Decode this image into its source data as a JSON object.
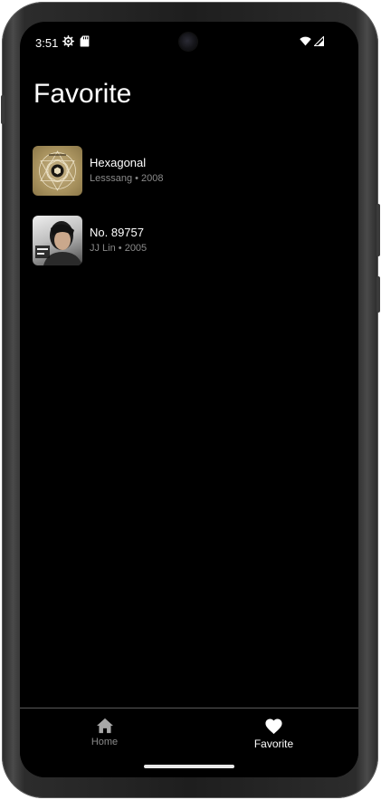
{
  "status_bar": {
    "time": "3:51",
    "left_icons": [
      "settings-icon",
      "sd-card-icon"
    ],
    "right_icons": [
      "wifi-icon",
      "signal-icon"
    ]
  },
  "page": {
    "title": "Favorite"
  },
  "favorites": [
    {
      "title": "Hexagonal",
      "subtitle": "Lesssang • 2008",
      "cover": "hexagonal-album-cover"
    },
    {
      "title": "No. 89757",
      "subtitle": "JJ Lin • 2005",
      "cover": "jj-lin-album-cover"
    }
  ],
  "bottom_nav": {
    "items": [
      {
        "label": "Home",
        "icon": "home-icon",
        "selected": false
      },
      {
        "label": "Favorite",
        "icon": "heart-icon",
        "selected": true
      }
    ]
  },
  "colors": {
    "background": "#000000",
    "text": "#ffffff",
    "secondary_text": "#8a8a8a"
  }
}
